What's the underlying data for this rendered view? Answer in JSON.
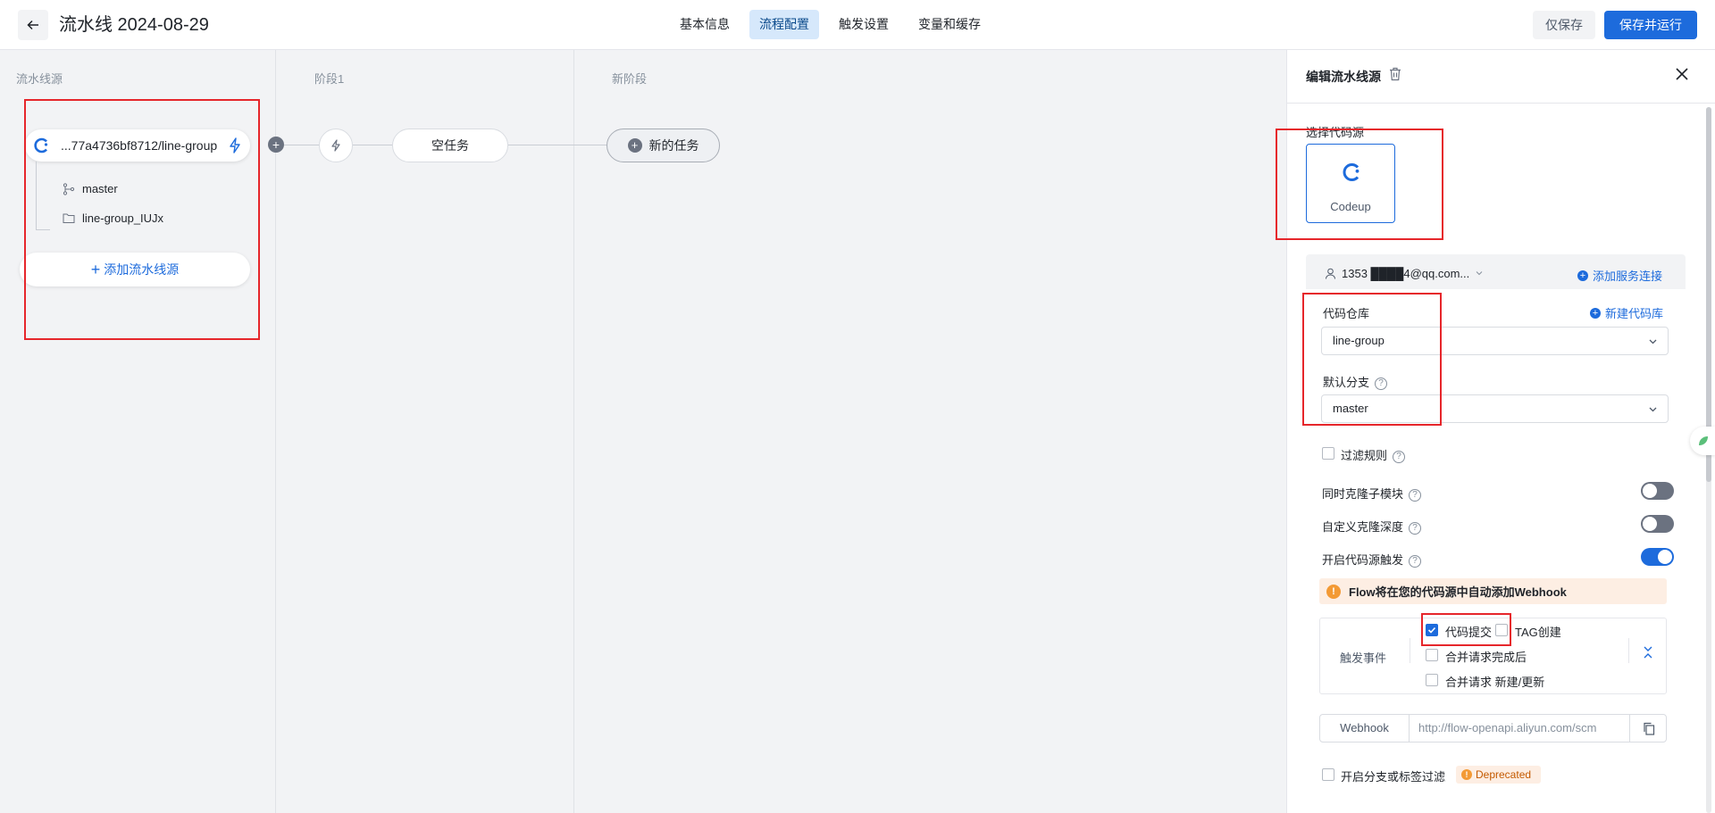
{
  "header": {
    "title": "流水线 2024-08-29",
    "tabs": [
      {
        "label": "基本信息"
      },
      {
        "label": "流程配置"
      },
      {
        "label": "触发设置"
      },
      {
        "label": "变量和缓存"
      }
    ],
    "save_only": "仅保存",
    "save_and_run": "保存并运行"
  },
  "canvas": {
    "col_source": "流水线源",
    "col_stage1": "阶段1",
    "col_new_stage": "新阶段",
    "source_name": "...77a4736bf8712/line-group",
    "branch": "master",
    "repo": "line-group_IUJx",
    "add_source": "添加流水线源",
    "empty_task": "空任务",
    "new_task": "新的任务"
  },
  "panel": {
    "title": "编辑流水线源",
    "select_source_label": "选择代码源",
    "codeup_label": "Codeup",
    "account": "1353 ████4@qq.com...",
    "add_service_conn": "添加服务连接",
    "repo_label": "代码仓库",
    "new_repo": "新建代码库",
    "repo_value": "line-group",
    "branch_label": "默认分支",
    "branch_value": "master",
    "filter_rules": "过滤规则",
    "clone_submodules": "同时克隆子模块",
    "custom_clone_depth": "自定义克隆深度",
    "enable_source_trigger": "开启代码源触发",
    "webhook_warning": "Flow将在您的代码源中自动添加Webhook",
    "trigger_events_label": "触发事件",
    "event_code_commit": "代码提交",
    "event_tag_create": "TAG创建",
    "event_mr_done": "合并请求完成后",
    "event_mr_new": "合并请求 新建/更新",
    "webhook_label": "Webhook",
    "webhook_value": "http://flow-openapi.aliyun.com/scm",
    "branch_tag_filter": "开启分支或标签过滤",
    "deprecated": "Deprecated",
    "toggles": {
      "clone_submodules": false,
      "custom_clone_depth": false,
      "enable_source_trigger": true
    },
    "checks": {
      "filter_rules": false,
      "code_commit": true,
      "tag_create": false,
      "mr_done": false,
      "mr_new": false,
      "branch_tag_filter": false
    }
  },
  "colors": {
    "accent": "#1d6bdc",
    "annotation": "#e6262b",
    "warning": "#f39a35"
  }
}
